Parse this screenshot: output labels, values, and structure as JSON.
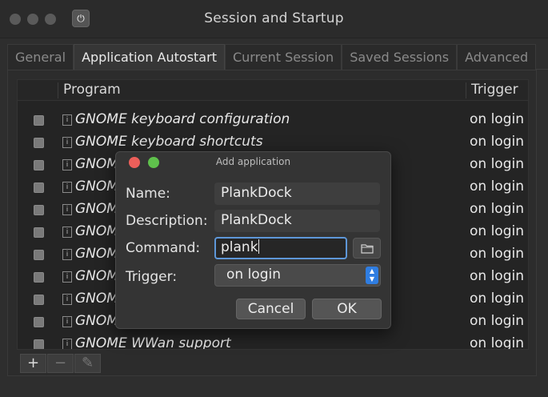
{
  "window": {
    "title": "Session and Startup"
  },
  "tabs": [
    {
      "label": "General"
    },
    {
      "label": "Application Autostart"
    },
    {
      "label": "Current Session"
    },
    {
      "label": "Saved Sessions"
    },
    {
      "label": "Advanced"
    }
  ],
  "list": {
    "columns": {
      "program": "Program",
      "trigger": "Trigger"
    },
    "rows": [
      {
        "name": "GNOME keyboard configuration",
        "trigger": "on login"
      },
      {
        "name": "GNOME keyboard shortcuts",
        "trigger": "on login"
      },
      {
        "name": "GNOM",
        "trigger": "on login"
      },
      {
        "name": "GNOM",
        "trigger": "on login"
      },
      {
        "name": "GNOM",
        "trigger": "on login"
      },
      {
        "name": "GNOM",
        "trigger": "on login"
      },
      {
        "name": "GNOM",
        "trigger": "on login"
      },
      {
        "name": "GNOM",
        "trigger": "on login"
      },
      {
        "name": "GNOM",
        "trigger": "on login"
      },
      {
        "name": "GNOM",
        "trigger": "on login"
      },
      {
        "name": "GNOME WWan support",
        "trigger": "on login"
      }
    ]
  },
  "toolbar": {
    "add": "+",
    "remove": "−",
    "edit": "✎"
  },
  "dialog": {
    "title": "Add application",
    "name_label": "Name:",
    "name_value": "PlankDock",
    "description_label": "Description:",
    "description_value": "PlankDock",
    "command_label": "Command:",
    "command_value": "plank",
    "trigger_label": "Trigger:",
    "trigger_value": "on login",
    "cancel_label": "Cancel",
    "ok_label": "OK"
  },
  "colors": {
    "accent": "#5e97d8",
    "combo_accent": "#2f7de1",
    "close_button": "#ec5f5a",
    "maximize_button": "#5fc14c"
  }
}
